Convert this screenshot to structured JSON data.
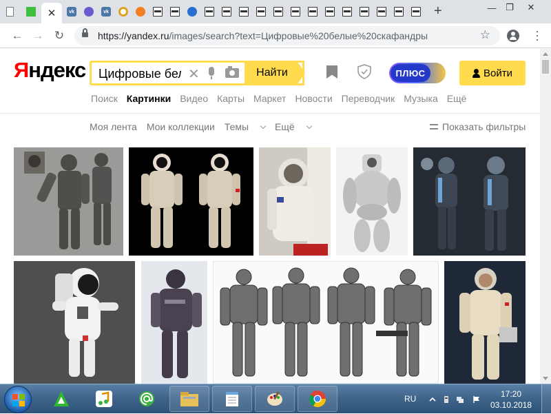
{
  "browser": {
    "tab_count_note": "",
    "url_host": "https://yandex.ru",
    "url_rest": "/images/search?text=Цифровые%20белые%20скафандры",
    "new_tab_label": "+",
    "window_controls": [
      "—",
      "❐",
      "✕"
    ]
  },
  "header": {
    "logo_first_letter": "Я",
    "logo_rest": "ндекс",
    "search_query": "Цифровые бел",
    "find_button": "Найти",
    "plus_label": "ПЛЮС",
    "login_button": "Войти"
  },
  "services": [
    "Поиск",
    "Картинки",
    "Видео",
    "Карты",
    "Маркет",
    "Новости",
    "Переводчик",
    "Музыка",
    "Ещё"
  ],
  "active_service": "Картинки",
  "subnav": {
    "my_feed": "Моя лента",
    "my_collections": "Мои коллекции",
    "topics": "Темы",
    "more": "Ещё",
    "show_filters": "Показать фильтры"
  },
  "colors": {
    "yandex_red": "#ff0000",
    "search_yellow": "#ffdb4d",
    "plus_blue": "#2438c9"
  },
  "images": [
    "game-soldier-suit-concept",
    "two-cosmonauts-black-bg",
    "astronaut-close-up-flag",
    "white-bulky-suit-model",
    "dark-blue-scifi-suits",
    "white-astronaut-3d-model",
    "dark-armored-suit",
    "grey-armor-suit-sheet",
    "cosmonaut-museum-mannequin"
  ],
  "taskbar": {
    "lang": "RU",
    "time": "17:20",
    "date": "03.10.2018",
    "apps": [
      "start-orb",
      "a-launcher",
      "music-app",
      "mail-at",
      "file-explorer",
      "notepad",
      "paint",
      "chrome"
    ]
  }
}
